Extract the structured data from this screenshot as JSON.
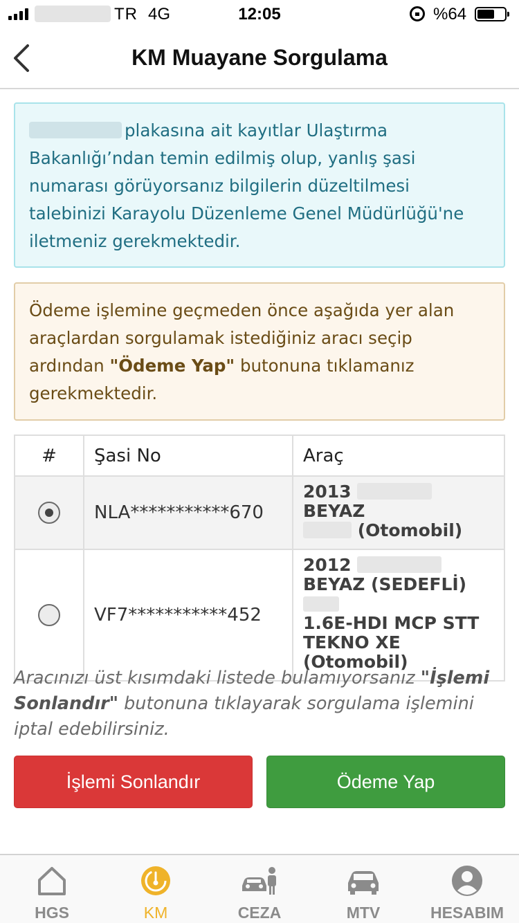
{
  "status_bar": {
    "carrier": "TR",
    "network": "4G",
    "time": "12:05",
    "battery_text": "%64",
    "battery_level": 0.64
  },
  "nav": {
    "title": "KM Muayane Sorgulama"
  },
  "info_alert": {
    "text": "plakasına ait kayıtlar Ulaştırma Bakanlığı’ndan temin edilmiş olup, yanlış şasi numarası görüyorsanız bilgilerin düzeltilmesi talebinizi Karayolu Düzenleme Genel Müdürlüğü'ne iletmeniz gerekmektedir."
  },
  "warning_alert": {
    "text_before": "Ödeme işlemine geçmeden önce aşağıda yer alan araçlardan sorgulamak istediğiniz aracı seçip ardından ",
    "bold": "\"Ödeme Yap\"",
    "text_after": " butonuna tıklamanız gerekmektedir."
  },
  "table": {
    "headers": [
      "#",
      "Şasi No",
      "Araç"
    ],
    "rows": [
      {
        "selected": true,
        "chassis": "NLA***********670",
        "vehicle_year": "2013",
        "vehicle_color": "BEYAZ",
        "vehicle_type": "(Otomobil)"
      },
      {
        "selected": false,
        "chassis": "VF7***********452",
        "vehicle_year": "2012",
        "vehicle_color": "BEYAZ (SEDEFLİ)",
        "vehicle_model_1": "1.6E-HDI MCP STT",
        "vehicle_model_2": "TEKNO XE",
        "vehicle_type": "(Otomobil)"
      }
    ]
  },
  "note": {
    "text_before": "Aracınızı üst kısımdaki listede bulamıyorsanız ",
    "bold": "\"İşlemi Sonlandır\"",
    "text_after": " butonuna tıklayarak sorgulama işlemini iptal edebilirsiniz."
  },
  "buttons": {
    "cancel": "İşlemi Sonlandır",
    "pay": "Ödeme Yap"
  },
  "tabs": [
    {
      "label": "HGS",
      "icon": "home-icon",
      "active": false
    },
    {
      "label": "KM",
      "icon": "speedometer-icon",
      "active": true
    },
    {
      "label": "CEZA",
      "icon": "police-car-icon",
      "active": false
    },
    {
      "label": "MTV",
      "icon": "car-icon",
      "active": false
    },
    {
      "label": "HESABIM",
      "icon": "user-icon",
      "active": false
    }
  ],
  "colors": {
    "danger": "#da3838",
    "success": "#3f9c3f",
    "tab_active": "#efb32a",
    "tab_inactive": "#8b8b8b"
  }
}
